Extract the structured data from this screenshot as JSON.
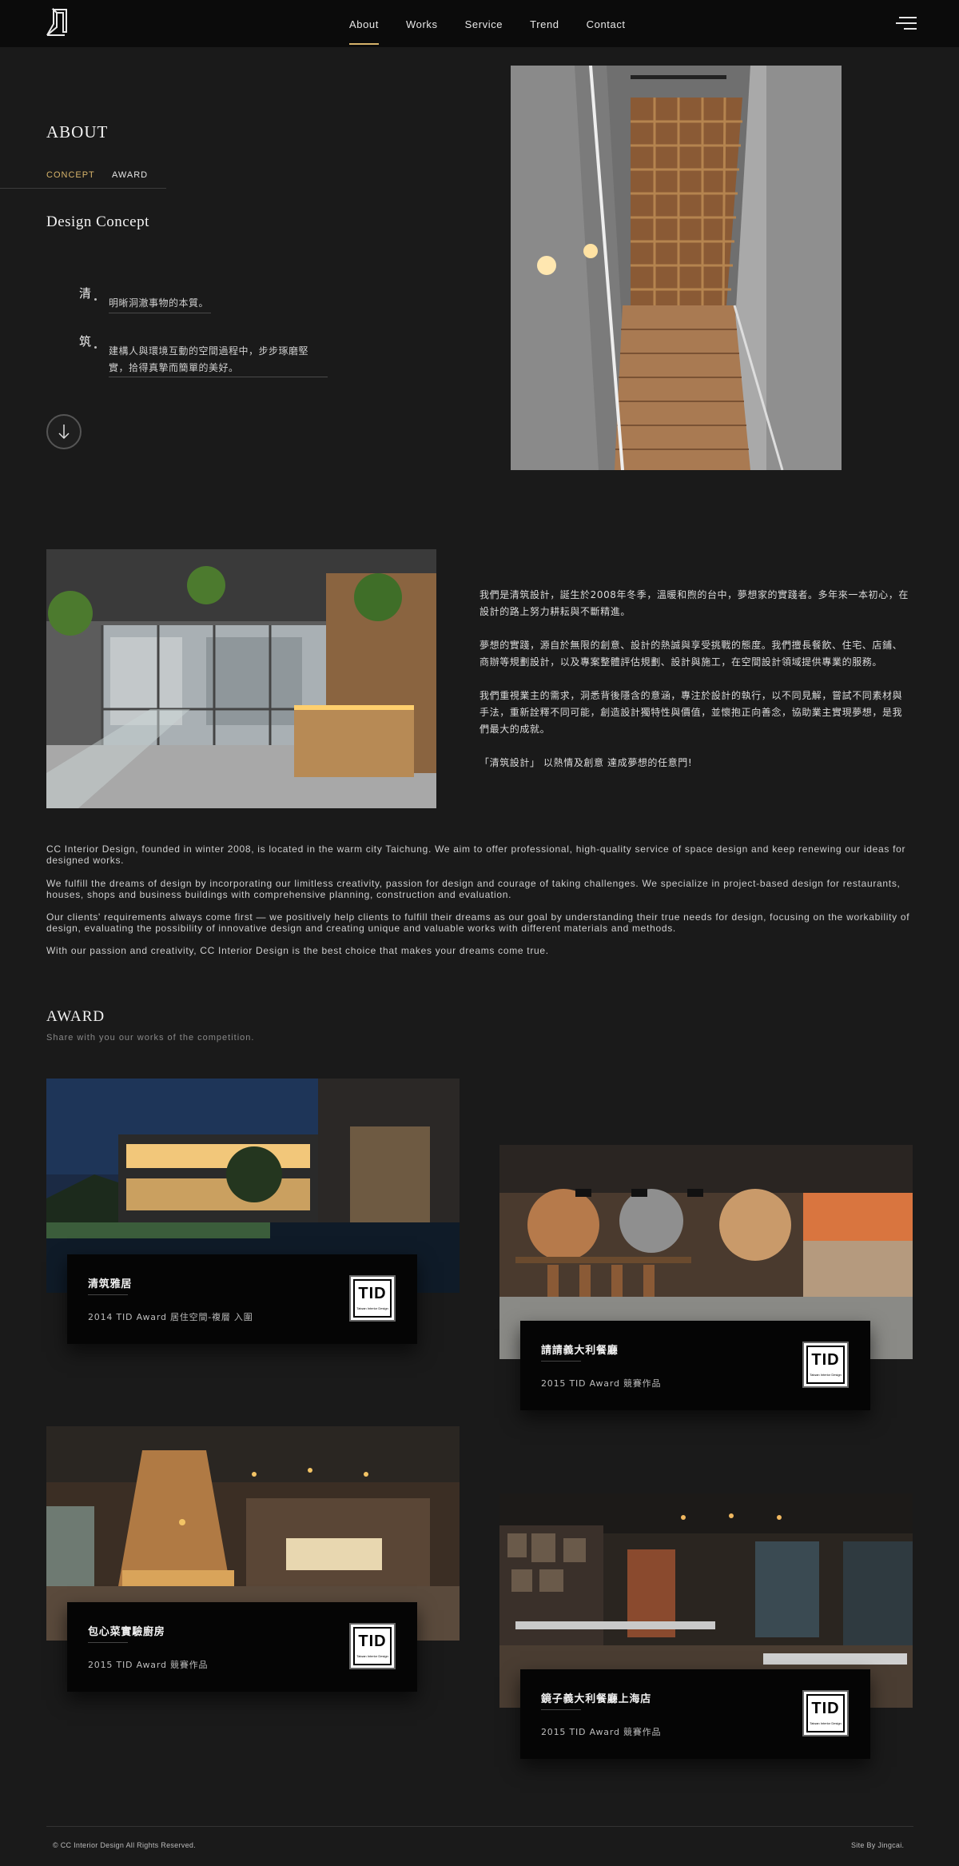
{
  "header": {
    "nav": [
      "About",
      "Works",
      "Service",
      "Trend",
      "Contact"
    ],
    "active_nav": "About",
    "accent_color": "#d6b36a"
  },
  "about": {
    "title": "ABOUT",
    "tabs": [
      "CONCEPT",
      "AWARD"
    ],
    "active_tab": "CONCEPT",
    "concept_heading": "Design Concept",
    "concepts": [
      {
        "char": "清",
        "lines": [
          "明晰洞澈事物的本質。"
        ]
      },
      {
        "char": "筑",
        "lines": [
          "建構人與環境互動的空間過程中，步步琢磨堅",
          "實，拾得真摯而簡單的美好。"
        ]
      }
    ]
  },
  "intro_cn": [
    "我們是清筑設計，誕生於2008年冬季，溫暖和煦的台中，夢想家的實踐者。多年來一本初心，在設計的路上努力耕耘與不斷精進。",
    "夢想的實踐，源自於無限的創意、設計的熱誠與享受挑戰的態度。我們擅長餐飲、住宅、店鋪、商辦等規劃設計，以及專案整體評估規劃、設計與施工，在空間設計領域提供專業的服務。",
    "我們重視業主的需求，洞悉背後隱含的意涵，專注於設計的執行，以不同見解，嘗試不同素材與手法，重新詮釋不同可能，創造設計獨特性與價值，並懷抱正向善念，協助業主實現夢想，是我們最大的成就。",
    "「清筑設計」 以熱情及創意 達成夢想的任意門!"
  ],
  "intro_en": [
    "CC Interior Design, founded in winter 2008, is located in the warm city Taichung. We aim to offer professional, high-quality service of space design and keep renewing our ideas for designed works.",
    "We fulfill the dreams of design by incorporating our limitless creativity, passion for design and courage of taking challenges. We specialize in project-based design for restaurants, houses, shops and business buildings with comprehensive planning, construction and evaluation.",
    "Our clients' requirements always come first — we positively help clients to fulfill their dreams as our goal by understanding their true needs for design, focusing on the workability of design, evaluating the possibility of innovative design and creating unique and valuable works with different materials and methods.",
    "With our passion and creativity, CC Interior Design is the best choice that makes your dreams come true."
  ],
  "award": {
    "title": "AWARD",
    "subtitle": "Share with you our works of the competition.",
    "badge": {
      "text": "TID",
      "small": "Taiwan Interior Design"
    },
    "items": [
      {
        "name": "清筑雅居",
        "desc": "2014 TID Award 居住空間-複層 入圍"
      },
      {
        "name": "請請義大利餐廳",
        "desc": "2015 TID Award 競賽作品"
      },
      {
        "name": "包心菜實驗廚房",
        "desc": "2015 TID Award 競賽作品"
      },
      {
        "name": "鏡子義大利餐廳上海店",
        "desc": "2015 TID Award 競賽作品"
      }
    ]
  },
  "footer": {
    "copyright": "© CC Interior Design All Rights Reserved.",
    "credit": "Site By Jingcai."
  }
}
